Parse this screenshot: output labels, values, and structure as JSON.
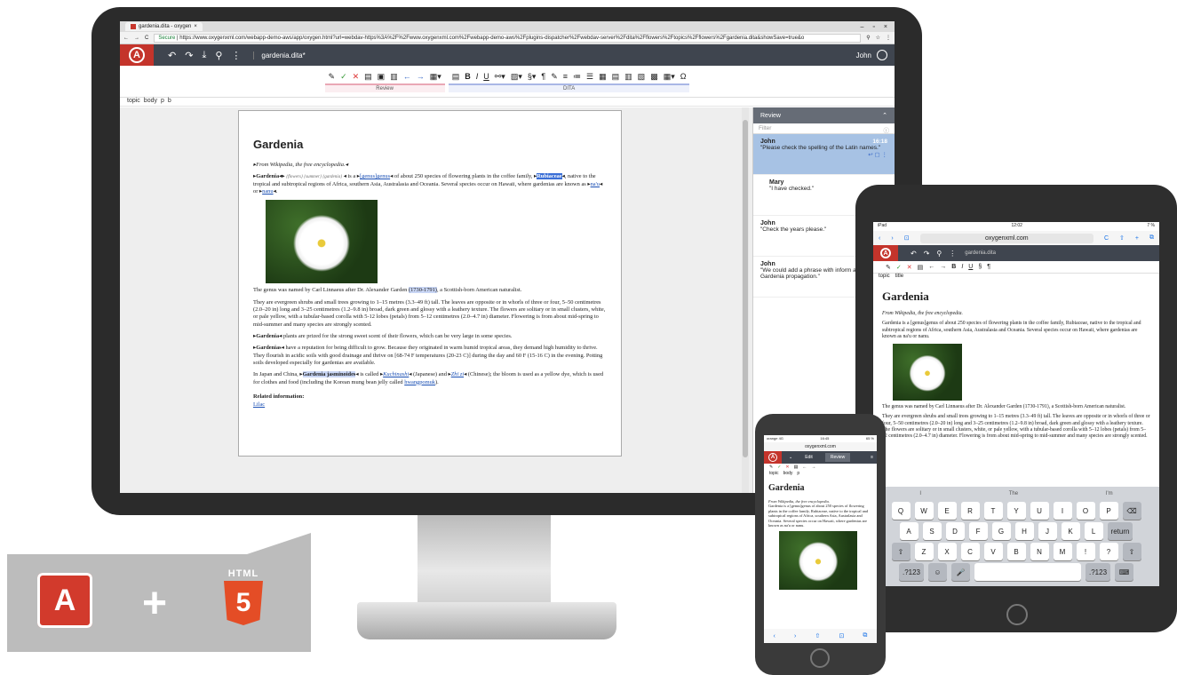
{
  "browser": {
    "tab_title": "gardenia.dita - oxygen",
    "secure": "Secure",
    "url": "https://www.oxygenxml.com/webapp-demo-aws/app/oxygen.html?url=webdav-https%3A%2F%2Fwww.oxygenxml.com%2Fwebapp-demo-aws%2Fplugins-dispatcher%2Fwebdav-server%2Fdita%2Fflowers%2Ftopics%2Fflowers%2Fgardenia.dita&showSave=true&o"
  },
  "app": {
    "doc_name": "gardenia.dita*",
    "user": "John"
  },
  "toolbar": {
    "review_label": "Review",
    "dita_label": "DITA"
  },
  "breadcrumb": [
    "topic",
    "body",
    "p",
    "b"
  ],
  "document": {
    "title": "Gardenia",
    "from": "From Wikipedia, the free encyclopedia.",
    "p1_a": "Gardenia",
    "p1_tags": "{flowers} {summer} {gardenia}",
    "p1_b": "is a",
    "p1_genus": "[genus]genus",
    "p1_c": "of about 250 species of flowering plants in the coffee family,",
    "p1_rub": "Rubiaceae",
    "p1_d": ", native to the tropical and subtropical regions of Africa, southern Asia, Australasia and Oceania. Several species occur on Hawaii, where gardenias are known as",
    "p1_naia": "na'u",
    "p1_or": "or",
    "p1_nanu": "nanu",
    "p2_a": "The genus was named by Carl Linnaeus after Dr. Alexander Garden",
    "p2_years": "(1730-1791)",
    "p2_b": ", a Scottish-born American naturalist.",
    "p3": "They are evergreen shrubs and small trees growing to 1–15 metres (3.3–49 ft) tall. The leaves are opposite or in whorls of three or four, 5–50 centimetres (2.0–20 in) long and 3–25 centimetres (1.2–9.8 in) broad, dark green and glossy with a leathery texture. The flowers are solitary or in small clusters, white, or pale yellow, with a tubular-based corolla with 5-12 lobes (petals) from 5–12 centimetres (2.0–4.7 in) diameter. Flowering is from about mid-spring to mid-summer and many species are strongly scented.",
    "p4_a": "Gardenia",
    "p4_b": "plants are prized for the strong sweet scent of their flowers, which can be very large in some species.",
    "p5_a": "Gardenias",
    "p5_b": "have a reputation for being difficult to grow. Because they originated in warm humid tropical areas, they demand high humidity to thrive. They flourish in acidic soils with good drainage and thrive on [68-74 F temperatures (20-23 C)] during the day and 60 F (15-16 C) in the evening. Potting soils developed especially for gardenias are available.",
    "p6_a": "In Japan and China,",
    "p6_b": "Gardenia jasminoides",
    "p6_c": "is called",
    "p6_d": "Kuchinashi",
    "p6_e": "(Japanese) and",
    "p6_f": "Zhī zi",
    "p6_g": "(Chinese); the bloom is used as a yellow dye, which is used for clothes and food (including the Korean mung bean jelly called",
    "p6_h": "hwangpomuk",
    "p6_i": ").",
    "related": "Related information:",
    "related_link": "Lilac"
  },
  "review": {
    "title": "Review",
    "filter": "Filter",
    "comments": [
      {
        "author": "John",
        "time": "16:18",
        "text": "\"Please check the spelling of the Latin names.\""
      },
      {
        "author": "Mary",
        "time": "",
        "text": "\"I have checked.\""
      },
      {
        "author": "John",
        "time": "",
        "text": "\"Check the years please.\""
      },
      {
        "author": "John",
        "time": "",
        "text": "\"We could add a phrase with inform about Gardenia propagation.\""
      }
    ]
  },
  "tablet": {
    "status_left": "iPad",
    "time": "12:02",
    "battery": "7 %",
    "url": "oxygenxml.com",
    "doc_name": "gardenia.dita",
    "breadcrumb": [
      "topic",
      "title"
    ],
    "title": "Gardenia",
    "from": "From Wikipedia, the free encyclopedia.",
    "p1": "Gardenia is a [genus]genus of about 250 species of flowering plants in the coffee family, Rubiaceae, native to the tropical and subtropical regions of Africa, southern Asia, Australasia and Oceania. Several species occur on Hawaii, where gardenias are known as na'u or nanu.",
    "p2": "The genus was named by Carl Linnaeus after Dr. Alexander Garden (1730-1791), a Scottish-born American naturalist.",
    "p3": "They are evergreen shrubs and small trees growing to 1–15 metres (3.3–49 ft) tall. The leaves are opposite or in whorls of three or four, 5–50 centimetres (2.0–20 in) long and 3–25 centimetres (1.2–9.8 in) broad, dark green and glossy with a leathery texture. The flowers are solitary or in small clusters, white, or pale yellow, with a tubular-based corolla with 5–12 lobes (petals) from 5–12 centimetres (2.0–4.7 in) diameter. Flowering is from about mid-spring to mid-summer and many species are strongly scented.",
    "suggestions": [
      "I",
      "The",
      "I'm"
    ],
    "keys_row1": [
      "Q",
      "W",
      "E",
      "R",
      "T",
      "Y",
      "U",
      "I",
      "O",
      "P",
      "⌫"
    ],
    "keys_row2": [
      "A",
      "S",
      "D",
      "F",
      "G",
      "H",
      "J",
      "K",
      "L",
      "return"
    ],
    "keys_row3": [
      "⇧",
      "Z",
      "X",
      "C",
      "V",
      "B",
      "N",
      "M",
      "!",
      "?",
      "⇧"
    ],
    "keys_row4": [
      ".?123",
      "☺",
      "🎤",
      "",
      ".?123",
      "⌨"
    ]
  },
  "phone": {
    "carrier": "orange 4G",
    "time": "16:45",
    "battery": "65 %",
    "url": "oxygenxml.com",
    "tab_edit": "Edit",
    "tab_review": "Review",
    "breadcrumb": [
      "topic",
      "body",
      "p"
    ],
    "title": "Gardenia",
    "from": "From Wikipedia, the free encyclopedia.",
    "p1": "Gardenia is a [genus]genus of about 250 species of flowering plants in the coffee family, Rubiaceae, native to the tropical and subtropical regions of Africa, southern Asia, Australasia and Oceania. Several species occur on Hawaii, where gardenias are known as na'u or nanu."
  },
  "badge": {
    "plus": "+",
    "html5_label": "HTML",
    "html5_num": "5"
  }
}
